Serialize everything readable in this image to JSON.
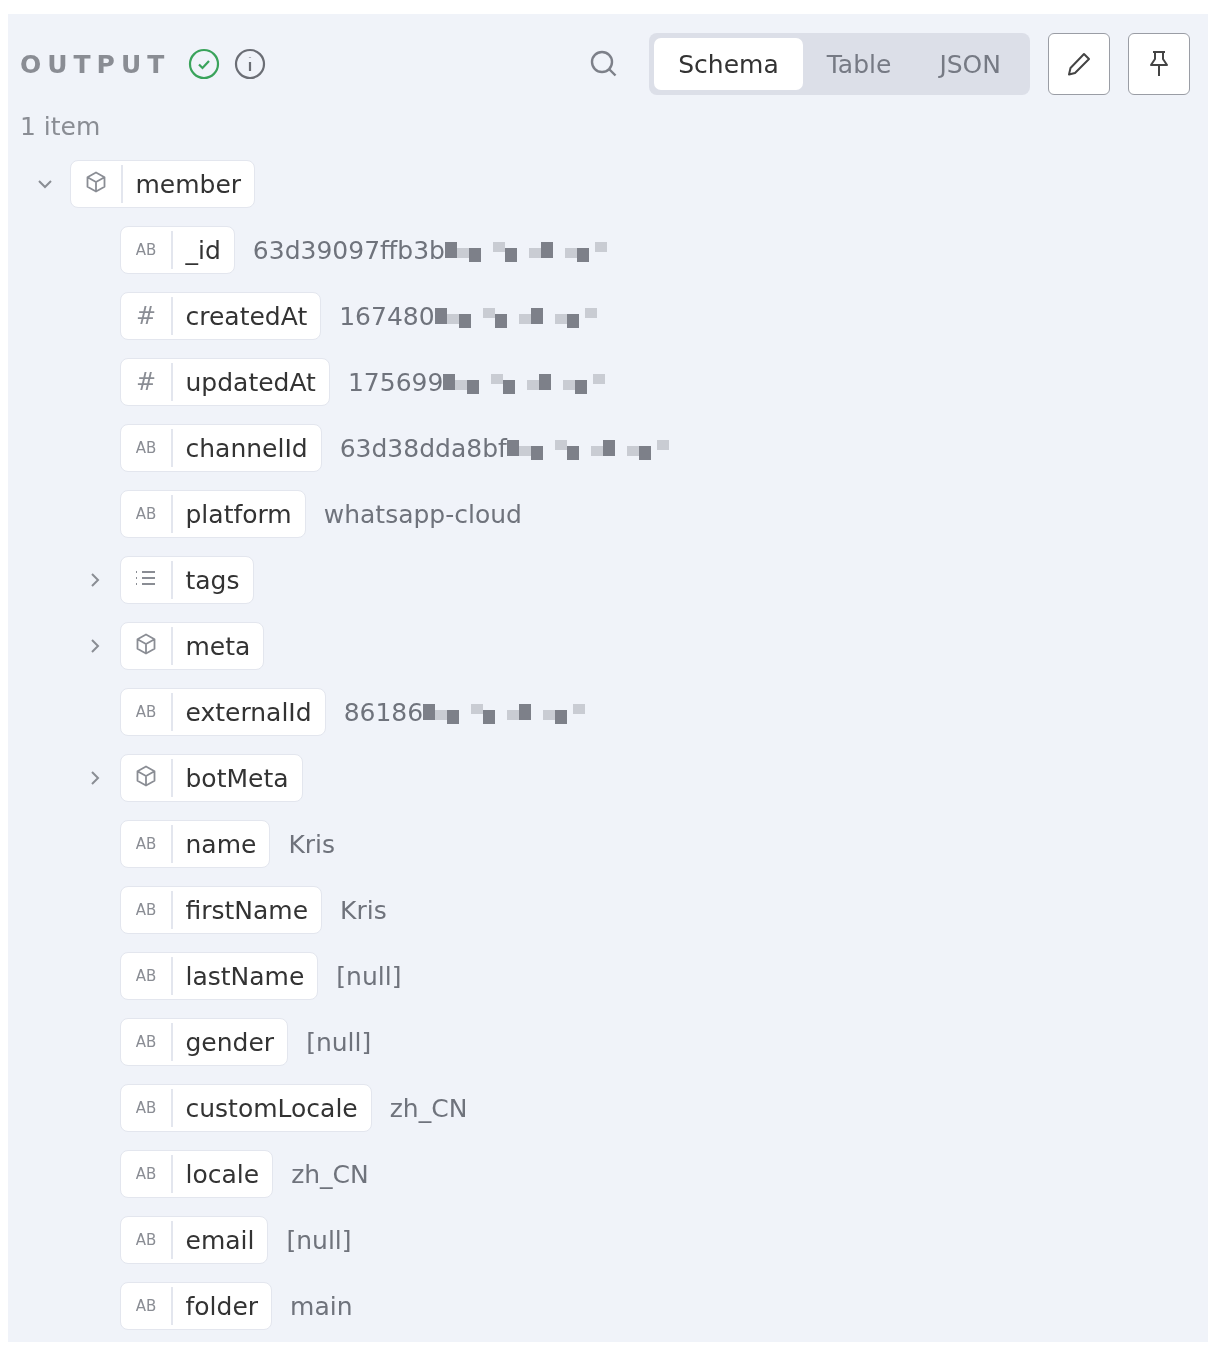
{
  "header": {
    "title": "OUTPUT",
    "success": true,
    "tabs": [
      {
        "label": "Schema",
        "selected": true
      },
      {
        "label": "Table",
        "selected": false
      },
      {
        "label": "JSON",
        "selected": false
      }
    ]
  },
  "count": "1 item",
  "tree": [
    {
      "name": "member",
      "kind": "object",
      "expanded": true,
      "children": [
        {
          "name": "_id",
          "kind": "string",
          "type_glyph": "AB",
          "value": "63d39097ffb3b",
          "redacted": true
        },
        {
          "name": "createdAt",
          "kind": "number",
          "type_glyph": "#",
          "value": "167480",
          "redacted": true
        },
        {
          "name": "updatedAt",
          "kind": "number",
          "type_glyph": "#",
          "value": "175699",
          "redacted": true
        },
        {
          "name": "channelId",
          "kind": "string",
          "type_glyph": "AB",
          "value": "63d38dda8bf",
          "redacted": true
        },
        {
          "name": "platform",
          "kind": "string",
          "type_glyph": "AB",
          "value": "whatsapp-cloud"
        },
        {
          "name": "tags",
          "kind": "array",
          "expanded": false
        },
        {
          "name": "meta",
          "kind": "object",
          "expanded": false
        },
        {
          "name": "externalId",
          "kind": "string",
          "type_glyph": "AB",
          "value": "86186",
          "redacted": true
        },
        {
          "name": "botMeta",
          "kind": "object",
          "expanded": false
        },
        {
          "name": "name",
          "kind": "string",
          "type_glyph": "AB",
          "value": "Kris"
        },
        {
          "name": "firstName",
          "kind": "string",
          "type_glyph": "AB",
          "value": "Kris"
        },
        {
          "name": "lastName",
          "kind": "string",
          "type_glyph": "AB",
          "value": "[null]"
        },
        {
          "name": "gender",
          "kind": "string",
          "type_glyph": "AB",
          "value": "[null]"
        },
        {
          "name": "customLocale",
          "kind": "string",
          "type_glyph": "AB",
          "value": "zh_CN"
        },
        {
          "name": "locale",
          "kind": "string",
          "type_glyph": "AB",
          "value": "zh_CN"
        },
        {
          "name": "email",
          "kind": "string",
          "type_glyph": "AB",
          "value": "[null]"
        },
        {
          "name": "folder",
          "kind": "string",
          "type_glyph": "AB",
          "value": "main"
        }
      ]
    }
  ]
}
